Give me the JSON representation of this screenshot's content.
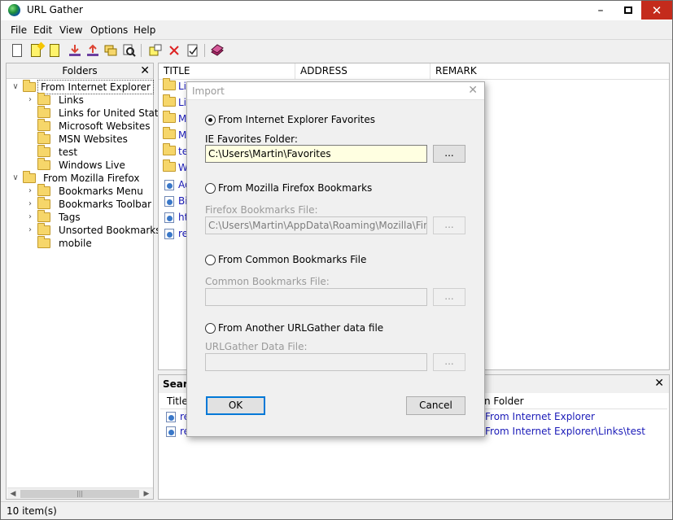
{
  "window": {
    "title": "URL Gather"
  },
  "menu": [
    "File",
    "Edit",
    "View",
    "Options",
    "Help"
  ],
  "folders_pane": {
    "header": "Folders",
    "tree": [
      {
        "label": "From Internet Explorer",
        "level": 0,
        "expanded": true,
        "selected": true
      },
      {
        "label": "Links",
        "level": 1,
        "expandable": true
      },
      {
        "label": "Links for United States",
        "level": 1
      },
      {
        "label": "Microsoft Websites",
        "level": 1
      },
      {
        "label": "MSN Websites",
        "level": 1
      },
      {
        "label": "test",
        "level": 1
      },
      {
        "label": "Windows Live",
        "level": 1
      },
      {
        "label": "From Mozilla Firefox",
        "level": 0,
        "expanded": true
      },
      {
        "label": "Bookmarks Menu",
        "level": 1,
        "expandable": true
      },
      {
        "label": "Bookmarks Toolbar",
        "level": 1,
        "expandable": true
      },
      {
        "label": "Tags",
        "level": 1,
        "expandable": true
      },
      {
        "label": "Unsorted Bookmarks",
        "level": 1,
        "expandable": true
      },
      {
        "label": "mobile",
        "level": 1
      }
    ]
  },
  "list_pane": {
    "columns": [
      "TITLE",
      "ADDRESS",
      "REMARK"
    ],
    "rows": [
      {
        "type": "folder",
        "title": "Lin"
      },
      {
        "type": "folder",
        "title": "Lin"
      },
      {
        "type": "folder",
        "title": "Mi"
      },
      {
        "type": "folder",
        "title": "MS"
      },
      {
        "type": "folder",
        "title": "te"
      },
      {
        "type": "folder",
        "title": "W"
      },
      {
        "type": "link",
        "title": "Ad"
      },
      {
        "type": "link",
        "title": "Bi"
      },
      {
        "type": "link",
        "title": "ht"
      },
      {
        "type": "link",
        "title": "re"
      }
    ]
  },
  "search_pane": {
    "title": "Searc",
    "columns": [
      "Title",
      "n Folder"
    ],
    "rows": [
      {
        "title": "re",
        "folder": "From Internet Explorer"
      },
      {
        "title": "re",
        "folder": "From Internet Explorer\\Links\\test"
      }
    ]
  },
  "status": "10 item(s)",
  "dialog": {
    "title": "Import",
    "options": [
      {
        "label": "From Internet Explorer Favorites",
        "selected": true,
        "field_label": "IE Favorites Folder:",
        "value": "C:\\Users\\Martin\\Favorites",
        "enabled": true
      },
      {
        "label": "From Mozilla Firefox Bookmarks",
        "selected": false,
        "field_label": "Firefox Bookmarks File:",
        "value": "C:\\Users\\Martin\\AppData\\Roaming\\Mozilla\\Firefox\\",
        "enabled": false
      },
      {
        "label": "From Common Bookmarks File",
        "selected": false,
        "field_label": "Common Bookmarks File:",
        "value": "",
        "enabled": false
      },
      {
        "label": "From Another URLGather data file",
        "selected": false,
        "field_label": "URLGather Data File:",
        "value": "",
        "enabled": false
      }
    ],
    "browse_label": "...",
    "ok_label": "OK",
    "cancel_label": "Cancel"
  }
}
